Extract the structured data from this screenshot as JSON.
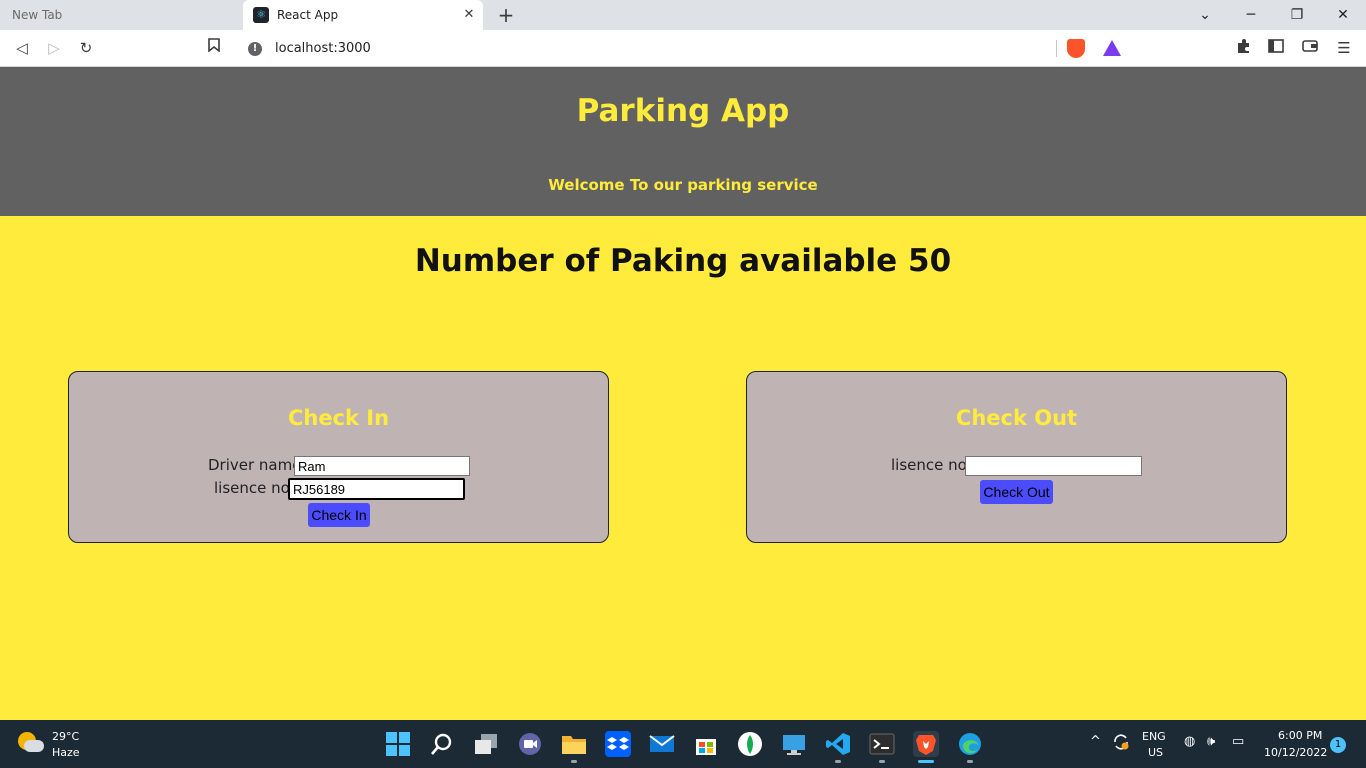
{
  "browser": {
    "tabs": [
      {
        "label": "New Tab",
        "active": false
      },
      {
        "label": "React App",
        "active": true
      }
    ],
    "new_tab_label": "+",
    "tab_close_label": "✕",
    "window_controls": {
      "dropdown": "⌄",
      "minimize": "─",
      "restore": "❐",
      "close": "✕"
    },
    "nav": {
      "back": "◁",
      "forward": "▷",
      "reload": "↻",
      "bookmark": "🔖"
    },
    "address": "localhost:3000",
    "extensions_icon": "puzzle-icon",
    "sidebar_icon": "sidebar-icon",
    "wallet_icon": "wallet-icon",
    "menu_icon": "☰"
  },
  "app": {
    "title": "Parking App",
    "subtitle": "Welcome To our parking service",
    "availability_text": "Number of Paking available 50",
    "checkin": {
      "title": "Check In",
      "driver_label": "Driver name",
      "driver_value": "Ram",
      "license_label": "lisence no.",
      "license_value": "RJ56189",
      "button": "Check In"
    },
    "checkout": {
      "title": "Check Out",
      "license_label": "lisence no.",
      "license_value": "",
      "button": "Check Out"
    }
  },
  "taskbar": {
    "weather_temp": "29°C",
    "weather_cond": "Haze",
    "lang_line1": "ENG",
    "lang_line2": "US",
    "time": "6:00 PM",
    "date": "10/12/2022",
    "notifications": "1",
    "tray": {
      "chevron": "^",
      "wifi": "◍",
      "volume": "🕪",
      "battery": "▭"
    }
  },
  "colors": {
    "page_bg": "#ffeb3b",
    "header_bg": "#616161",
    "card_bg": "#bfb3b3",
    "accent_text": "#ffeb3b",
    "button_bg": "#4c4cff",
    "taskbar_bg": "#1c2a36"
  }
}
